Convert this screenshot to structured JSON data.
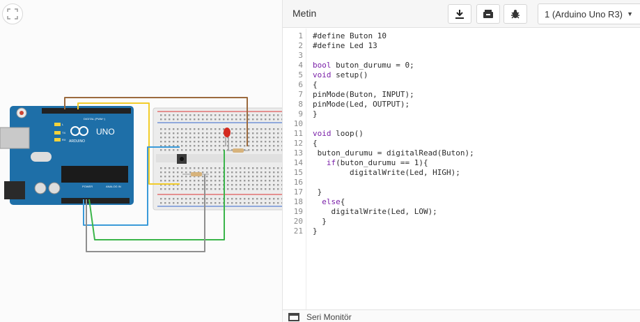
{
  "toolbar": {
    "mode_label": "Metin",
    "board_select": {
      "selected": "1 (Arduino Uno R3)"
    }
  },
  "board": {
    "model_text": "UNO",
    "brand_text": "ARDUINO",
    "digital_header": "DIGITAL (PWM~)",
    "power_header": "POWER",
    "analog_header": "ANALOG IN",
    "tx_label": "TX",
    "rx_label": "RX",
    "l_label": "L"
  },
  "code": {
    "lines": [
      "#define Buton 10",
      "#define Led 13",
      "",
      "bool buton_durumu = 0;",
      "void setup()",
      "{",
      "pinMode(Buton, INPUT);",
      "pinMode(Led, OUTPUT);",
      "}",
      "",
      "void loop()",
      "{",
      " buton_durumu = digitalRead(Buton);",
      "   if(buton_durumu == 1){",
      "        digitalWrite(Led, HIGH);",
      "",
      " }",
      "  else{",
      "    digitalWrite(Led, LOW);",
      "  }",
      "}"
    ]
  },
  "footer": {
    "serial_monitor_label": "Seri Monitör"
  },
  "colors": {
    "board": "#1e6fa8",
    "breadboard": "#ececec",
    "wire_brown": "#9b6a3e",
    "wire_yellow": "#f2cc2a",
    "wire_blue": "#3a9ad9",
    "wire_green": "#3ab54a",
    "wire_gray": "#8f8f8f",
    "led": "#d42a1f",
    "keyword": "#7a1fa8"
  }
}
